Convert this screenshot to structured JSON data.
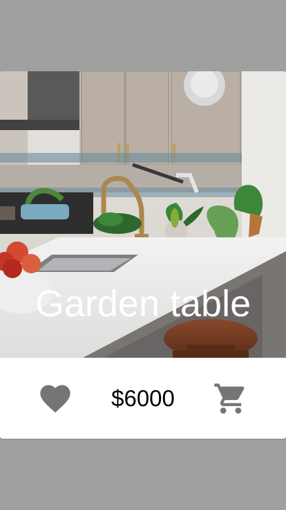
{
  "product": {
    "title": "Garden table",
    "price": "$6000"
  },
  "icons": {
    "favorite": "heart-icon",
    "cart": "shopping-cart-icon"
  },
  "colors": {
    "background": "#a0a0a0",
    "card": "#ffffff",
    "icon": "#757575",
    "price_text": "#000000",
    "title_text": "#ffffff"
  }
}
